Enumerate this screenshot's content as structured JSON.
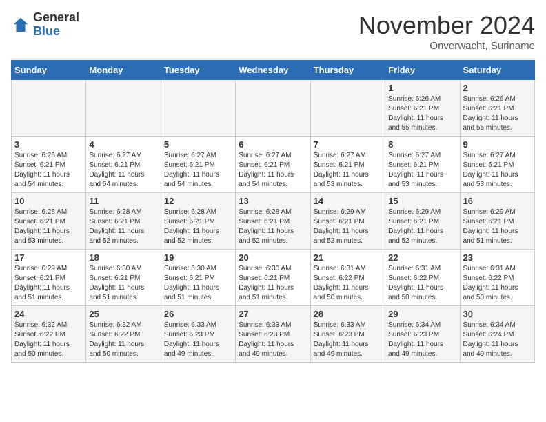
{
  "header": {
    "logo_general": "General",
    "logo_blue": "Blue",
    "month_title": "November 2024",
    "subtitle": "Onverwacht, Suriname"
  },
  "days_of_week": [
    "Sunday",
    "Monday",
    "Tuesday",
    "Wednesday",
    "Thursday",
    "Friday",
    "Saturday"
  ],
  "weeks": [
    [
      {
        "day": "",
        "info": ""
      },
      {
        "day": "",
        "info": ""
      },
      {
        "day": "",
        "info": ""
      },
      {
        "day": "",
        "info": ""
      },
      {
        "day": "",
        "info": ""
      },
      {
        "day": "1",
        "info": "Sunrise: 6:26 AM\nSunset: 6:21 PM\nDaylight: 11 hours\nand 55 minutes."
      },
      {
        "day": "2",
        "info": "Sunrise: 6:26 AM\nSunset: 6:21 PM\nDaylight: 11 hours\nand 55 minutes."
      }
    ],
    [
      {
        "day": "3",
        "info": "Sunrise: 6:26 AM\nSunset: 6:21 PM\nDaylight: 11 hours\nand 54 minutes."
      },
      {
        "day": "4",
        "info": "Sunrise: 6:27 AM\nSunset: 6:21 PM\nDaylight: 11 hours\nand 54 minutes."
      },
      {
        "day": "5",
        "info": "Sunrise: 6:27 AM\nSunset: 6:21 PM\nDaylight: 11 hours\nand 54 minutes."
      },
      {
        "day": "6",
        "info": "Sunrise: 6:27 AM\nSunset: 6:21 PM\nDaylight: 11 hours\nand 54 minutes."
      },
      {
        "day": "7",
        "info": "Sunrise: 6:27 AM\nSunset: 6:21 PM\nDaylight: 11 hours\nand 53 minutes."
      },
      {
        "day": "8",
        "info": "Sunrise: 6:27 AM\nSunset: 6:21 PM\nDaylight: 11 hours\nand 53 minutes."
      },
      {
        "day": "9",
        "info": "Sunrise: 6:27 AM\nSunset: 6:21 PM\nDaylight: 11 hours\nand 53 minutes."
      }
    ],
    [
      {
        "day": "10",
        "info": "Sunrise: 6:28 AM\nSunset: 6:21 PM\nDaylight: 11 hours\nand 53 minutes."
      },
      {
        "day": "11",
        "info": "Sunrise: 6:28 AM\nSunset: 6:21 PM\nDaylight: 11 hours\nand 52 minutes."
      },
      {
        "day": "12",
        "info": "Sunrise: 6:28 AM\nSunset: 6:21 PM\nDaylight: 11 hours\nand 52 minutes."
      },
      {
        "day": "13",
        "info": "Sunrise: 6:28 AM\nSunset: 6:21 PM\nDaylight: 11 hours\nand 52 minutes."
      },
      {
        "day": "14",
        "info": "Sunrise: 6:29 AM\nSunset: 6:21 PM\nDaylight: 11 hours\nand 52 minutes."
      },
      {
        "day": "15",
        "info": "Sunrise: 6:29 AM\nSunset: 6:21 PM\nDaylight: 11 hours\nand 52 minutes."
      },
      {
        "day": "16",
        "info": "Sunrise: 6:29 AM\nSunset: 6:21 PM\nDaylight: 11 hours\nand 51 minutes."
      }
    ],
    [
      {
        "day": "17",
        "info": "Sunrise: 6:29 AM\nSunset: 6:21 PM\nDaylight: 11 hours\nand 51 minutes."
      },
      {
        "day": "18",
        "info": "Sunrise: 6:30 AM\nSunset: 6:21 PM\nDaylight: 11 hours\nand 51 minutes."
      },
      {
        "day": "19",
        "info": "Sunrise: 6:30 AM\nSunset: 6:21 PM\nDaylight: 11 hours\nand 51 minutes."
      },
      {
        "day": "20",
        "info": "Sunrise: 6:30 AM\nSunset: 6:21 PM\nDaylight: 11 hours\nand 51 minutes."
      },
      {
        "day": "21",
        "info": "Sunrise: 6:31 AM\nSunset: 6:22 PM\nDaylight: 11 hours\nand 50 minutes."
      },
      {
        "day": "22",
        "info": "Sunrise: 6:31 AM\nSunset: 6:22 PM\nDaylight: 11 hours\nand 50 minutes."
      },
      {
        "day": "23",
        "info": "Sunrise: 6:31 AM\nSunset: 6:22 PM\nDaylight: 11 hours\nand 50 minutes."
      }
    ],
    [
      {
        "day": "24",
        "info": "Sunrise: 6:32 AM\nSunset: 6:22 PM\nDaylight: 11 hours\nand 50 minutes."
      },
      {
        "day": "25",
        "info": "Sunrise: 6:32 AM\nSunset: 6:22 PM\nDaylight: 11 hours\nand 50 minutes."
      },
      {
        "day": "26",
        "info": "Sunrise: 6:33 AM\nSunset: 6:23 PM\nDaylight: 11 hours\nand 49 minutes."
      },
      {
        "day": "27",
        "info": "Sunrise: 6:33 AM\nSunset: 6:23 PM\nDaylight: 11 hours\nand 49 minutes."
      },
      {
        "day": "28",
        "info": "Sunrise: 6:33 AM\nSunset: 6:23 PM\nDaylight: 11 hours\nand 49 minutes."
      },
      {
        "day": "29",
        "info": "Sunrise: 6:34 AM\nSunset: 6:23 PM\nDaylight: 11 hours\nand 49 minutes."
      },
      {
        "day": "30",
        "info": "Sunrise: 6:34 AM\nSunset: 6:24 PM\nDaylight: 11 hours\nand 49 minutes."
      }
    ]
  ]
}
